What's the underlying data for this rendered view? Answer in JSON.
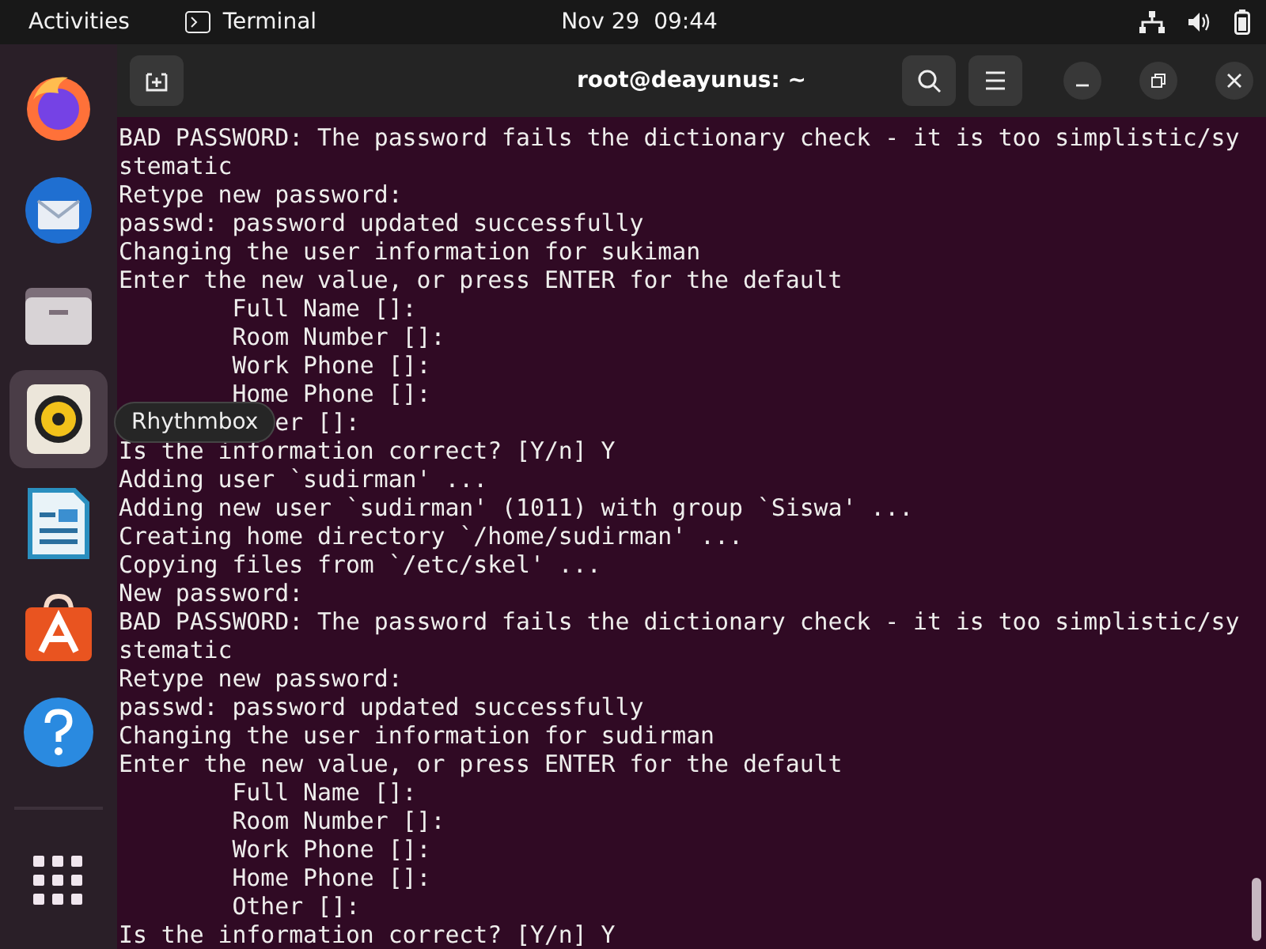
{
  "top_bar": {
    "activities": "Activities",
    "app_name": "Terminal",
    "clock": "Nov 29  09:44"
  },
  "dock": {
    "items": [
      {
        "kind": "firefox",
        "selected": false
      },
      {
        "kind": "thunderbird",
        "selected": false
      },
      {
        "kind": "files",
        "selected": false
      },
      {
        "kind": "rhythmbox",
        "selected": true
      },
      {
        "kind": "writer",
        "selected": false
      },
      {
        "kind": "store",
        "selected": false
      },
      {
        "kind": "help",
        "selected": false
      }
    ],
    "tooltip": "Rhythmbox"
  },
  "terminal": {
    "title": "root@deayunus: ~",
    "lines": [
      "BAD PASSWORD: The password fails the dictionary check - it is too simplistic/sy",
      "stematic",
      "Retype new password:",
      "passwd: password updated successfully",
      "Changing the user information for sukiman",
      "Enter the new value, or press ENTER for the default",
      "        Full Name []:",
      "        Room Number []:",
      "        Work Phone []:",
      "        Home Phone []:",
      "           er []:",
      "Is the information correct? [Y/n] Y",
      "Adding user `sudirman' ...",
      "Adding new user `sudirman' (1011) with group `Siswa' ...",
      "Creating home directory `/home/sudirman' ...",
      "Copying files from `/etc/skel' ...",
      "New password:",
      "BAD PASSWORD: The password fails the dictionary check - it is too simplistic/sy",
      "stematic",
      "Retype new password:",
      "passwd: password updated successfully",
      "Changing the user information for sudirman",
      "Enter the new value, or press ENTER for the default",
      "        Full Name []:",
      "        Room Number []:",
      "        Work Phone []:",
      "        Home Phone []:",
      "        Other []:",
      "Is the information correct? [Y/n] Y"
    ]
  }
}
